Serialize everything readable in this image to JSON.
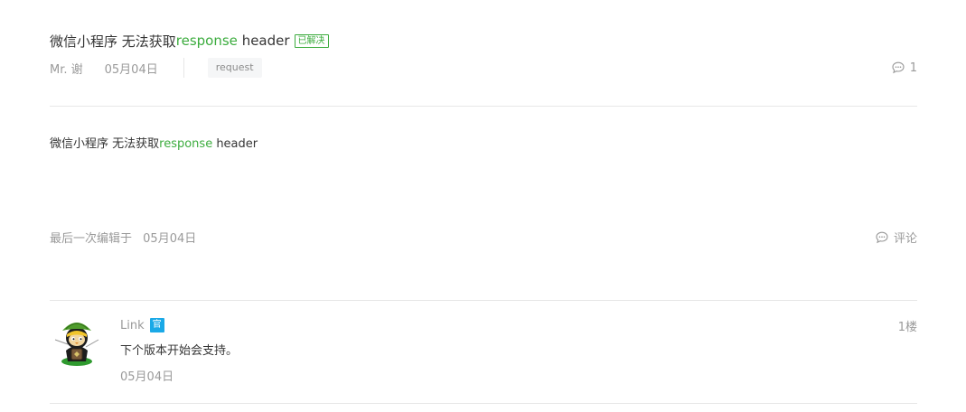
{
  "post": {
    "title_prefix": "微信小程序 无法获取",
    "title_highlight": "response",
    "title_suffix": " header",
    "status_badge": "已解决",
    "author": "Mr. 谢",
    "date": "05月04日",
    "tag": "request",
    "comment_count": "1",
    "body_prefix": "微信小程序 无法获取",
    "body_highlight": "response",
    "body_suffix": " header",
    "last_edit_label": "最后一次编辑于",
    "last_edit_date": "05月04日",
    "comment_button_label": "评论"
  },
  "reply": {
    "author": "Link",
    "official_badge": "官",
    "text": "下个版本开始会支持。",
    "date": "05月04日",
    "floor": "1楼"
  },
  "colors": {
    "accent_green": "#3cac3e",
    "official_blue": "#1aa9e7",
    "muted_text": "#9a9a9a",
    "divider": "#e7e7e7"
  },
  "icons": {
    "comment": "speech-bubble-icon"
  }
}
